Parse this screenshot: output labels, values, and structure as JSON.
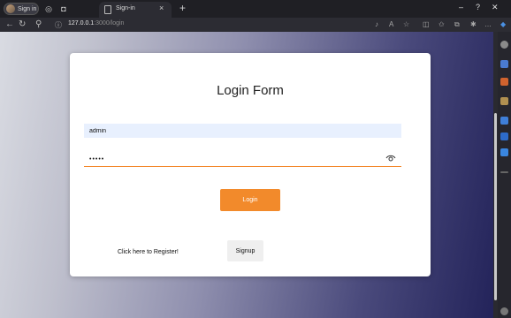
{
  "browser": {
    "profile_label": "Sign in",
    "tab_title": "Sign-in",
    "tab_close": "×",
    "new_tab": "+",
    "url_host": "127.0.0.1",
    "url_rest": ":3000/login"
  },
  "form": {
    "title": "Login Form",
    "username_value": "admin",
    "password_value": "•••••",
    "login_label": "Login",
    "register_prompt": "Click here to Register!",
    "signup_label": "Signup"
  },
  "icons": {
    "back": "back-arrow-icon",
    "refresh": "refresh-icon",
    "search": "search-icon",
    "info": "site-info-icon",
    "eye": "eye-icon"
  },
  "colors": {
    "accent": "#f28a2b",
    "input_fill": "#e8f0fe"
  }
}
